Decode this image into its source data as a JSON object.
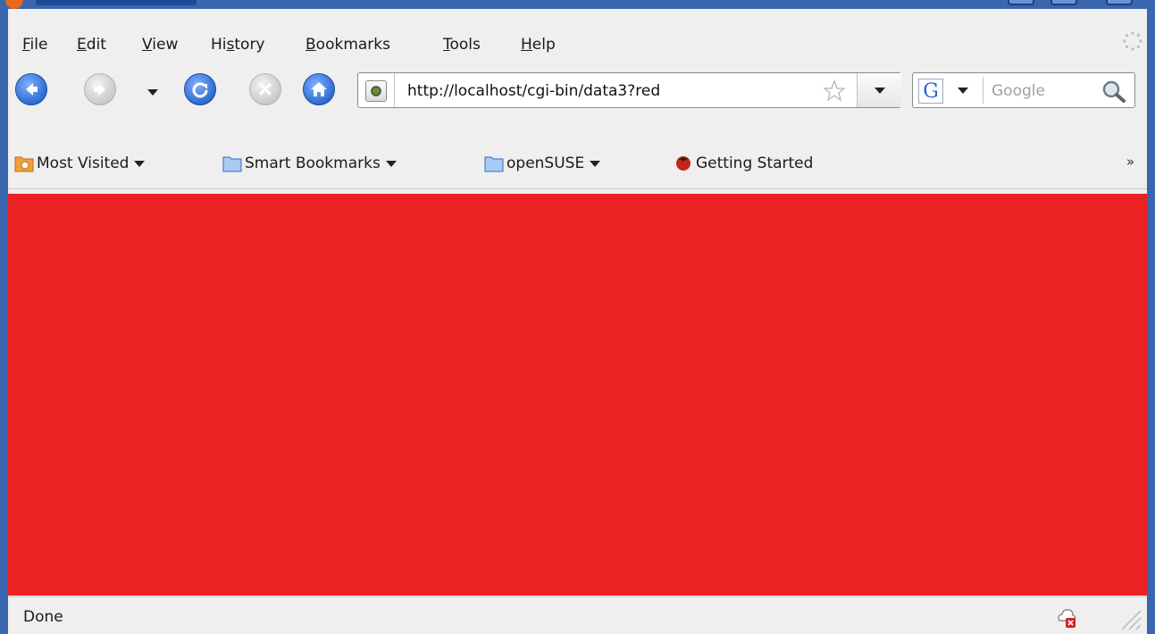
{
  "colors": {
    "frame": "#3a66b0",
    "content_background": "#ec2124",
    "chrome": "#efefef"
  },
  "menu": [
    {
      "label": "File",
      "accel_index": 0
    },
    {
      "label": "Edit",
      "accel_index": 0
    },
    {
      "label": "View",
      "accel_index": 0
    },
    {
      "label": "History",
      "accel_index": 2
    },
    {
      "label": "Bookmarks",
      "accel_index": 0
    },
    {
      "label": "Tools",
      "accel_index": 0
    },
    {
      "label": "Help",
      "accel_index": 0
    }
  ],
  "navigation": {
    "url": "http://localhost/cgi-bin/data3?red",
    "search_engine_icon": "google-g-icon",
    "search_placeholder": "Google",
    "icons": [
      "back-icon",
      "forward-icon",
      "history-dropdown-icon",
      "reload-icon",
      "stop-icon",
      "home-icon"
    ]
  },
  "bookmarks": {
    "items": [
      {
        "label": "Most Visited",
        "icon": "smart-folder-icon",
        "has_dropdown": true
      },
      {
        "label": "Smart Bookmarks",
        "icon": "folder-icon",
        "has_dropdown": true
      },
      {
        "label": "openSUSE",
        "icon": "folder-icon",
        "has_dropdown": true
      },
      {
        "label": "Getting Started",
        "icon": "firefox-icon",
        "has_dropdown": false
      }
    ],
    "overflow": "»"
  },
  "status": {
    "text": "Done"
  }
}
